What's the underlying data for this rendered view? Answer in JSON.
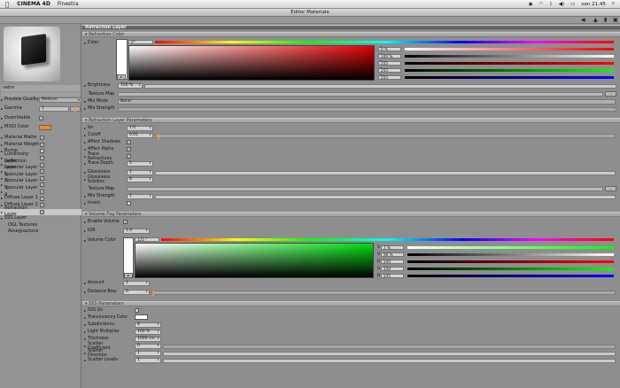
{
  "menubar": {
    "app": "CINEMA 4D",
    "menu": "Finestra",
    "clock": "ven 21.45"
  },
  "window": {
    "title": "Editor Materiale"
  },
  "left": {
    "material_name": "vetro",
    "preview_quality_label": "Preview Quality",
    "preview_quality_value": "Medium",
    "gamma_label": "Gamma",
    "gamma_value": "1",
    "overridable_label": "Overridable",
    "mxid_label": "MXID Color",
    "mxid_color": "#f08a1c",
    "layers": [
      "Material Matte",
      "Material Weigth",
      "Bump",
      "Luminosity Layer",
      "Reflection Layer",
      "Specular Layer 1",
      "Specular Layer 2",
      "Specular Layer 3",
      "Specular Layer 4",
      "Diffuse Layer 1",
      "Diffuse Layer 2",
      "Refraction Layer",
      "SSS Layer",
      "OGL Textures",
      "Assegnazione"
    ]
  },
  "refraction": {
    "header": "Refraction Layer",
    "sub": "Refraction Color",
    "color_label": "Color",
    "top_value": "0°",
    "S": "0 %",
    "V": "100 %",
    "R": "255",
    "G": "255",
    "B": "255",
    "brightness_label": "Brightness",
    "brightness_value": "100 %",
    "texture_map_label": "Texture Map",
    "mix_mode_label": "Mix Mode",
    "mix_mode_value": "None",
    "mix_strength_label": "Mix Strength"
  },
  "refr_params": {
    "header": "Refraction Layer Parameters",
    "ior_label": "Ior",
    "ior_value": "1.6",
    "cutoff_label": "Cutoff",
    "cutoff_value": "0.01",
    "affect_shadows": "Affect Shadows",
    "affect_alpha": "Affect Alpha",
    "trace_refractions": "Trace Refractions",
    "trace_depth_label": "Trace Depth",
    "trace_depth_value": "5",
    "glossiness_label": "Glossiness",
    "glossiness_value": "1",
    "gloss_subdivs_label": "Glossiness Subdivs",
    "gloss_subdivs_value": "8",
    "texture_map_label": "Texture Map",
    "mix_strength_label": "Mix Strength",
    "mix_strength_value": "1",
    "invert_label": "Invert"
  },
  "fog": {
    "header": "Volume Fog Parameters",
    "enable_label": "Enable Volume",
    "ior_label": "IOR",
    "ior_value": "1.0",
    "color_label": "Volume Color",
    "top_value": "125 °",
    "S": "7 %",
    "V": "96 %",
    "R": "244",
    "G": "249",
    "B": "245",
    "amount_label": "Amount",
    "amount_value": "1",
    "distance_label": "Distance Bias",
    "distance_value": "0"
  },
  "sss": {
    "header": "SSS Parameters",
    "sss_on_label": "SSS On",
    "translucency_label": "Translucency Color",
    "subdivisions_label": "Subdivisions",
    "subdivisions_value": "8",
    "light_mult_label": "Light Multiplier",
    "light_mult_value": "100 %",
    "thickness_label": "Thickness",
    "thickness_value": "1000 cm",
    "scatter_coef_label": "Scatter Coefficient",
    "scatter_coef_value": "0",
    "scatter_dir_label": "Scatter Direction",
    "scatter_dir_value": "1",
    "scatter_levels_label": "Scatter Levels",
    "scatter_levels_value": "1"
  },
  "channel_labels": {
    "S": "S",
    "V": "V",
    "R": "R",
    "G": "G",
    "B": "B"
  }
}
